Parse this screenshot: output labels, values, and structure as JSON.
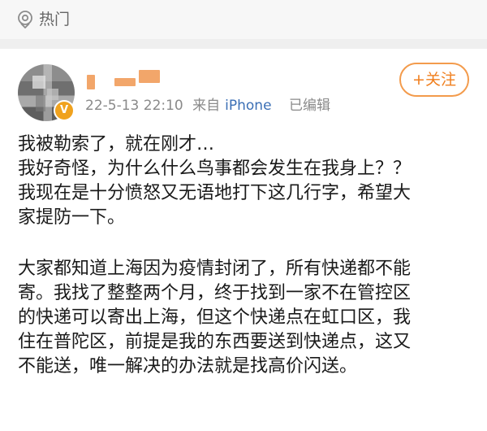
{
  "header": {
    "hot_label": "热门",
    "hot_icon": "location-pin-icon"
  },
  "post": {
    "author_avatar_icon": "avatar",
    "verified_badge_icon": "verified-v-icon",
    "verified_badge_text": "V",
    "timestamp": "22-5-13 22:10",
    "source_prefix": "来自",
    "source": "iPhone",
    "edited_label": "已编辑",
    "follow_button_label": "+关注",
    "colors": {
      "accent": "#f07f1e",
      "source_link": "#3b6fb5",
      "meta": "#8a8a8a"
    },
    "lines_paragraph_1": [
      "我被勒索了，就在刚才…",
      "我好奇怪，为什么什么鸟事都会发生在我身上？？",
      "我现在是十分愤怒又无语地打下这几行字，希望大",
      "家提防一下。"
    ],
    "lines_paragraph_2": [
      "大家都知道上海因为疫情封闭了，所有快递都不能",
      "寄。我找了整整两个月，终于找到一家不在管控区",
      "的快递可以寄出上海，但这个快递点在虹口区，我",
      "住在普陀区，前提是我的东西要送到快递点，这又",
      "不能送，唯一解决的办法就是找高价闪送。"
    ]
  }
}
